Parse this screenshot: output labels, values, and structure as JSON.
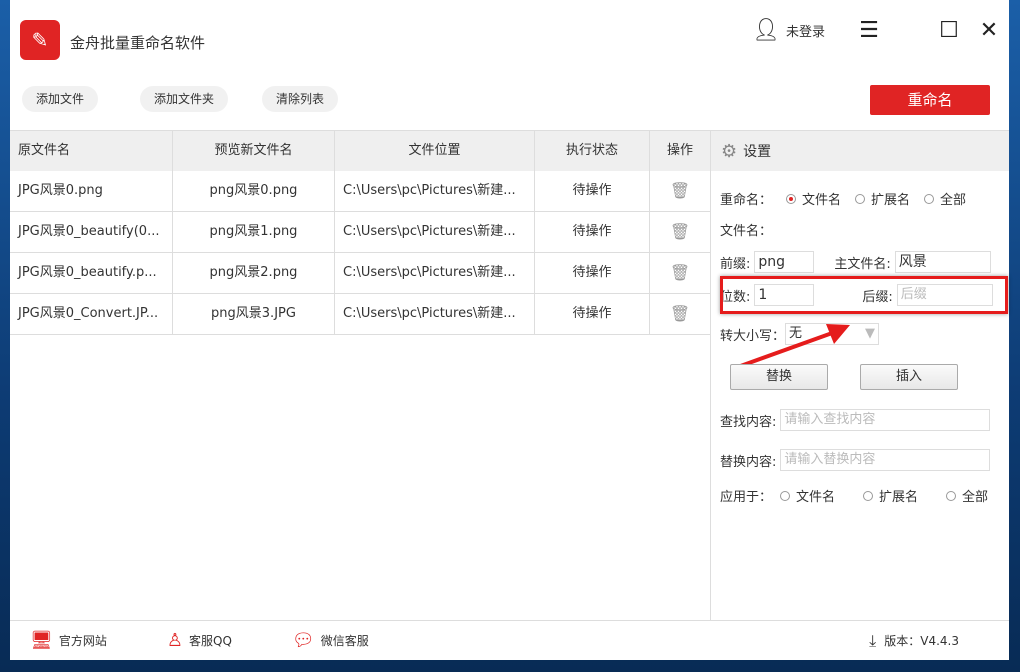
{
  "app": {
    "title": "金舟批量重命名软件",
    "user": "未登录"
  },
  "toolbar": {
    "add_file": "添加文件",
    "add_folder": "添加文件夹",
    "clear_list": "清除列表",
    "rename": "重命名"
  },
  "table": {
    "headers": [
      "原文件名",
      "预览新文件名",
      "文件位置",
      "执行状态",
      "操作"
    ],
    "rows": [
      [
        "JPG风景0.png",
        "png风景0.png",
        "C:\\Users\\pc\\Pictures\\新建...",
        "待操作"
      ],
      [
        "JPG风景0_beautify(0...",
        "png风景1.png",
        "C:\\Users\\pc\\Pictures\\新建...",
        "待操作"
      ],
      [
        "JPG风景0_beautify.p...",
        "png风景2.png",
        "C:\\Users\\pc\\Pictures\\新建...",
        "待操作"
      ],
      [
        "JPG风景0_Convert.JP...",
        "png风景3.JPG",
        "C:\\Users\\pc\\Pictures\\新建...",
        "待操作"
      ]
    ]
  },
  "settings": {
    "title": "设置",
    "rename_label": "重命名：",
    "opt_filename": "文件名",
    "opt_ext": "扩展名",
    "opt_all": "全部",
    "filename_label": "文件名：",
    "prefix_label": "前缀:",
    "prefix_value": "png",
    "main_label": "主文件名:",
    "main_value": "风景",
    "digits_label": "位数:",
    "digits_value": "1",
    "suffix_label": "后缀:",
    "suffix_placeholder": "后缀",
    "case_label": "转大小写：",
    "case_value": "无",
    "replace_btn": "替换",
    "insert_btn": "插入",
    "find_label": "查找内容:",
    "find_placeholder": "请输入查找内容",
    "replace_label": "替换内容:",
    "replace_placeholder": "请输入替换内容",
    "apply_label": "应用于："
  },
  "footer": {
    "website": "官方网站",
    "qq": "客服QQ",
    "wechat": "微信客服",
    "version": "版本：V4.4.3"
  },
  "colors": {
    "accent": "#e02424"
  }
}
